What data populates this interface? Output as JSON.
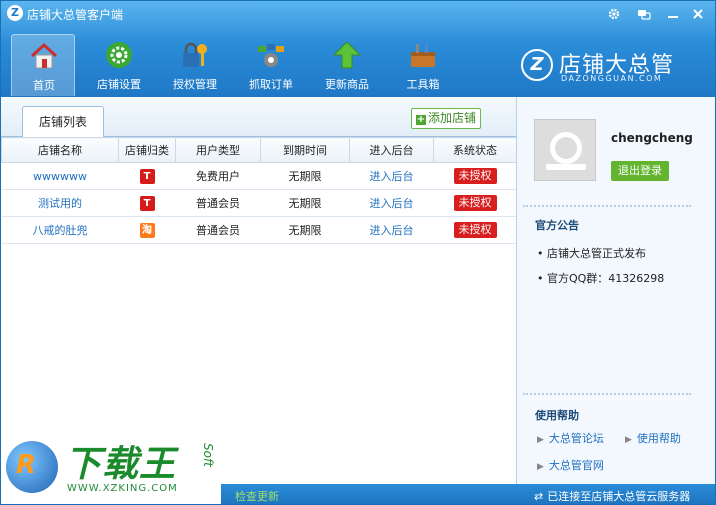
{
  "window": {
    "title": "店铺大总管客户端",
    "logo_letter": "Z"
  },
  "nav": [
    {
      "label": "首页",
      "icon": "home-icon"
    },
    {
      "label": "店铺设置",
      "icon": "gear-icon"
    },
    {
      "label": "授权管理",
      "icon": "lock-key-icon"
    },
    {
      "label": "抓取订单",
      "icon": "grab-order-icon"
    },
    {
      "label": "更新商品",
      "icon": "up-arrow-icon"
    },
    {
      "label": "工具箱",
      "icon": "toolbox-icon"
    }
  ],
  "brand": {
    "text": "店铺大总管",
    "subtext": "DAZONGGUAN.COM",
    "mark": "Z"
  },
  "main": {
    "tab_label": "店铺列表",
    "add_store_label": "添加店铺",
    "add_store_icon": "+",
    "columns": [
      "店铺名称",
      "店铺归类",
      "用户类型",
      "到期时间",
      "进入后台",
      "系统状态"
    ],
    "rows": [
      {
        "name": "wwwwww",
        "platform": "T",
        "platform_kind": "tmall",
        "user_type": "免费用户",
        "expiry": "无期限",
        "enter": "进入后台",
        "status": "未授权"
      },
      {
        "name": "测试用的",
        "platform": "T",
        "platform_kind": "tmall",
        "user_type": "普通会员",
        "expiry": "无期限",
        "enter": "进入后台",
        "status": "未授权"
      },
      {
        "name": "八戒的肚兜",
        "platform": "淘",
        "platform_kind": "taobao",
        "user_type": "普通会员",
        "expiry": "无期限",
        "enter": "进入后台",
        "status": "未授权"
      }
    ]
  },
  "sidebar": {
    "username": "chengcheng",
    "logout_label": "退出登录",
    "notice_title": "官方公告",
    "notices": [
      "• 店铺大总管正式发布",
      "• 官方QQ群：41326298"
    ],
    "help_title": "使用帮助",
    "help_links": [
      "大总管论坛",
      "使用帮助",
      "大总管官网"
    ],
    "help_arrow": "▶"
  },
  "statusbar": {
    "check_update": "检查更新",
    "connection": "已连接至店铺大总管云服务器",
    "sync_glyph": "⇄"
  },
  "watermark": {
    "logo_letter": "R",
    "text": "下载王",
    "url": "WWW.XZKING.COM",
    "soft": "Soft"
  },
  "colors": {
    "header_blue": "#2a8cd8",
    "status_red": "#d81e1e",
    "accent_green": "#63b530",
    "link_blue": "#2170c0"
  }
}
